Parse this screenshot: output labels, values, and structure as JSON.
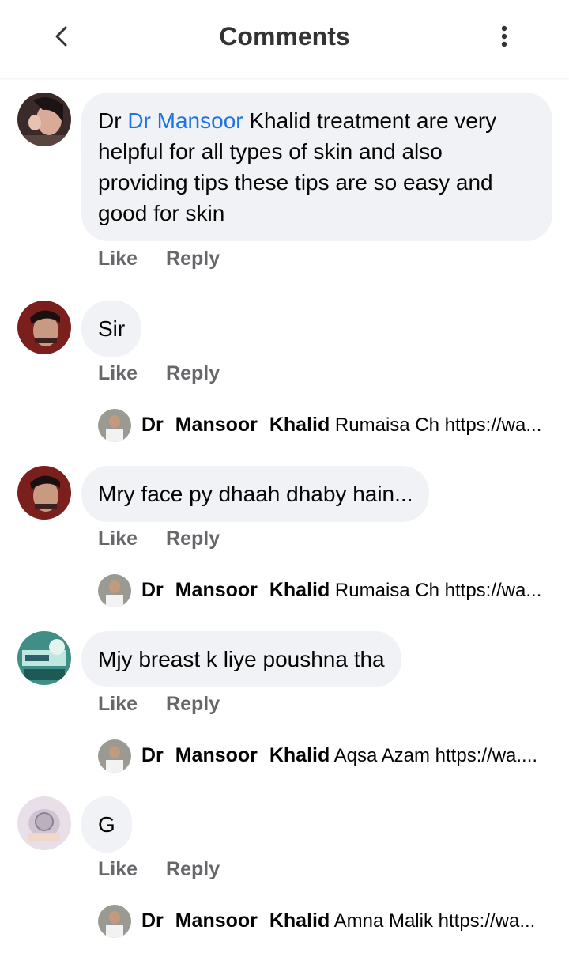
{
  "header": {
    "title": "Comments"
  },
  "comments": [
    {
      "prefix": "Dr ",
      "mention": "Dr  Mansoor",
      "text": "  Khalid treatment are very helpful for all types of skin and also providing tips these tips are so easy and good for skin",
      "like": "Like",
      "reply": "Reply"
    },
    {
      "text": "Sir",
      "like": "Like",
      "reply": "Reply",
      "replyPreview": {
        "name": "Dr  Mansoor  Khalid",
        "text": "Rumaisa Ch https://wa..."
      }
    },
    {
      "text": "Mry face py dhaah dhaby hain...",
      "like": "Like",
      "reply": "Reply",
      "replyPreview": {
        "name": "Dr  Mansoor  Khalid",
        "text": "Rumaisa Ch https://wa..."
      }
    },
    {
      "text": "Mjy breast k liye poushna tha",
      "like": "Like",
      "reply": "Reply",
      "replyPreview": {
        "name": "Dr  Mansoor  Khalid",
        "text": "Aqsa Azam https://wa...."
      }
    },
    {
      "text": "G",
      "like": "Like",
      "reply": "Reply",
      "replyPreview": {
        "name": "Dr  Mansoor  Khalid",
        "text": "Amna Malik https://wa..."
      }
    }
  ]
}
